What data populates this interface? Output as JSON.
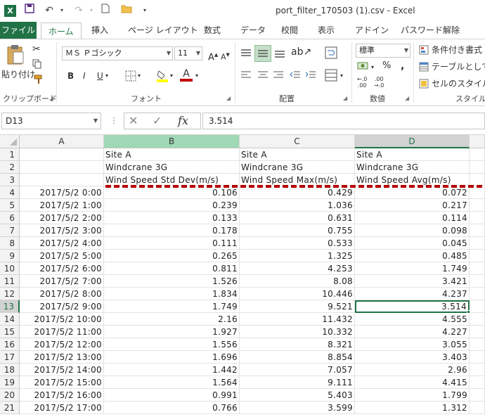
{
  "app": {
    "logo": "X",
    "title": "port_filter_170503 (1).csv - Excel"
  },
  "tabs": {
    "file": "ファイル",
    "items": [
      "ホーム",
      "挿入",
      "ページ レイアウト",
      "数式",
      "データ",
      "校閲",
      "表示",
      "アドイン",
      "パスワード解除"
    ],
    "active": "ホーム"
  },
  "ribbon": {
    "clipboard": {
      "paste": "貼り付け",
      "label": "クリップボード"
    },
    "font": {
      "name": "ＭＳ Ｐゴシック",
      "size": "11",
      "bold": "B",
      "italic": "I",
      "underline": "U",
      "label": "フォント",
      "font_color": "#c00000",
      "highlight": "#ffff00"
    },
    "alignment": {
      "label": "配置"
    },
    "number": {
      "format": "標準",
      "percent": "%",
      "comma": ",",
      "label": "数値"
    },
    "styles": {
      "conditional": "条件付き書式",
      "table": "テーブルとして書",
      "cell": "セルのスタイル",
      "label": "スタイル"
    }
  },
  "formula_bar": {
    "name_box": "D13",
    "fx": "fx",
    "value": "3.514"
  },
  "sheet": {
    "columns": [
      "A",
      "B",
      "C",
      "D"
    ],
    "selected_column": "D",
    "selected_row": "13",
    "header_rows": [
      {
        "row": "1",
        "b": "Site A",
        "c": "Site A",
        "d": "Site A"
      },
      {
        "row": "2",
        "b": "Windcrane 3G",
        "c": "Windcrane 3G",
        "d": "Windcrane 3G"
      },
      {
        "row": "3",
        "b": "Wind Speed  Std Dev(m/s)",
        "c": "Wind Speed  Max(m/s)",
        "d": "Wind Speed  Avg(m/s)"
      }
    ],
    "data_rows": [
      {
        "row": "4",
        "a": "2017/5/2 0:00",
        "b": "0.106",
        "c": "0.429",
        "d": "0.072"
      },
      {
        "row": "5",
        "a": "2017/5/2 1:00",
        "b": "0.239",
        "c": "1.036",
        "d": "0.217"
      },
      {
        "row": "6",
        "a": "2017/5/2 2:00",
        "b": "0.133",
        "c": "0.631",
        "d": "0.114"
      },
      {
        "row": "7",
        "a": "2017/5/2 3:00",
        "b": "0.178",
        "c": "0.755",
        "d": "0.098"
      },
      {
        "row": "8",
        "a": "2017/5/2 4:00",
        "b": "0.111",
        "c": "0.533",
        "d": "0.045"
      },
      {
        "row": "9",
        "a": "2017/5/2 5:00",
        "b": "0.265",
        "c": "1.325",
        "d": "0.485"
      },
      {
        "row": "10",
        "a": "2017/5/2 6:00",
        "b": "0.811",
        "c": "4.253",
        "d": "1.749"
      },
      {
        "row": "11",
        "a": "2017/5/2 7:00",
        "b": "1.526",
        "c": "8.08",
        "d": "3.421"
      },
      {
        "row": "12",
        "a": "2017/5/2 8:00",
        "b": "1.834",
        "c": "10.446",
        "d": "4.237"
      },
      {
        "row": "13",
        "a": "2017/5/2 9:00",
        "b": "1.749",
        "c": "9.521",
        "d": "3.514"
      },
      {
        "row": "14",
        "a": "2017/5/2 10:00",
        "b": "2.16",
        "c": "11.432",
        "d": "4.555"
      },
      {
        "row": "15",
        "a": "2017/5/2 11:00",
        "b": "1.927",
        "c": "10.332",
        "d": "4.227"
      },
      {
        "row": "16",
        "a": "2017/5/2 12:00",
        "b": "1.556",
        "c": "8.321",
        "d": "3.055"
      },
      {
        "row": "17",
        "a": "2017/5/2 13:00",
        "b": "1.696",
        "c": "8.854",
        "d": "3.403"
      },
      {
        "row": "18",
        "a": "2017/5/2 14:00",
        "b": "1.442",
        "c": "7.057",
        "d": "2.96"
      },
      {
        "row": "19",
        "a": "2017/5/2 15:00",
        "b": "1.564",
        "c": "9.111",
        "d": "4.415"
      },
      {
        "row": "20",
        "a": "2017/5/2 16:00",
        "b": "0.991",
        "c": "5.403",
        "d": "1.799"
      },
      {
        "row": "21",
        "a": "2017/5/2 17:00",
        "b": "0.766",
        "c": "3.599",
        "d": "1.312"
      }
    ],
    "annotation_color": "#b30000",
    "accent_color": "#217346"
  }
}
